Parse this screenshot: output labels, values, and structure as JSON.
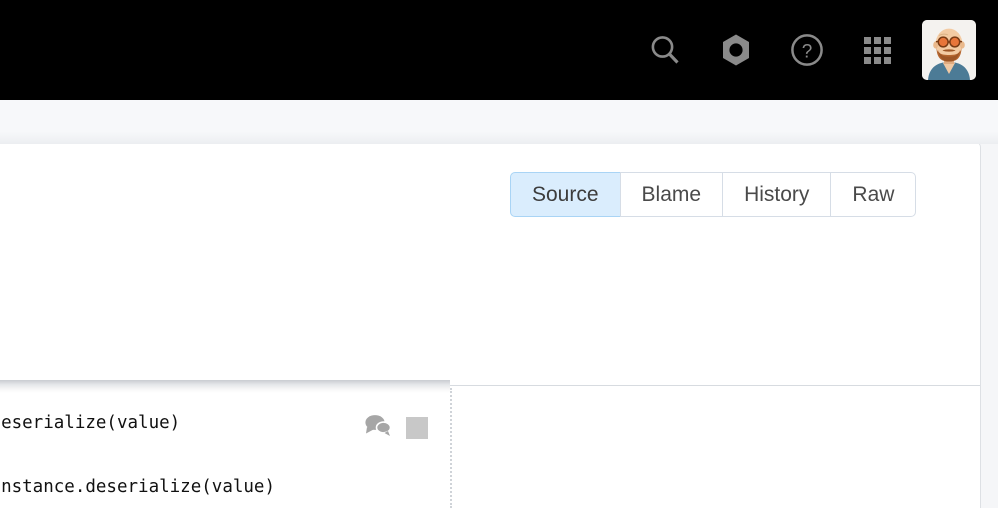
{
  "navbar": {
    "background": "#000000",
    "icon_color": "#8a8a8a",
    "items": [
      {
        "name": "search-icon",
        "label": "Search"
      },
      {
        "name": "settings-nut-icon",
        "label": "Settings"
      },
      {
        "name": "help-icon",
        "label": "Help"
      },
      {
        "name": "apps-grid-icon",
        "label": "Apps"
      },
      {
        "name": "avatar",
        "label": "Account"
      }
    ]
  },
  "file_view": {
    "tabs": [
      {
        "label": "Source",
        "active": true
      },
      {
        "label": "Blame",
        "active": false
      },
      {
        "label": "History",
        "active": false
      },
      {
        "label": "Raw",
        "active": false
      }
    ],
    "active_tab_bg": "#daedfd",
    "active_tab_border": "#a9d4f5",
    "tab_border": "#d6dde6"
  },
  "code": {
    "lines": [
      {
        "text": ".deserialize(value)",
        "has_comment_icon": true,
        "has_blank_square": true
      },
      {
        "text": ".Instance.deserialize(value)",
        "has_comment_icon": false,
        "has_blank_square": false
      }
    ],
    "text_color": "#111111",
    "comment_icon_color": "#a6a6a6",
    "square_color": "#c8c8c8"
  }
}
